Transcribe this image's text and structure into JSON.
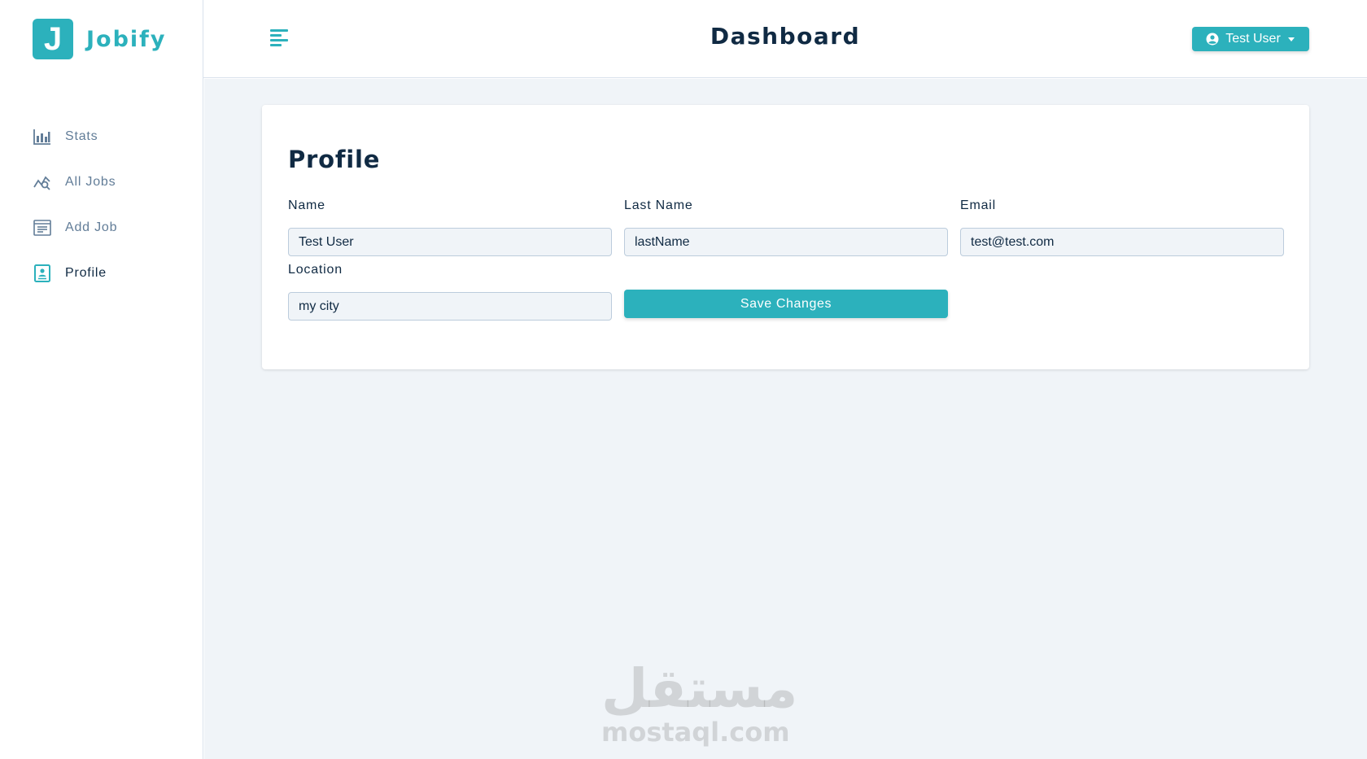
{
  "brand": {
    "logo_letter": "J",
    "name": "Jobify",
    "accent_color": "#2cb1bc"
  },
  "sidebar": {
    "items": [
      {
        "label": "Stats",
        "icon": "bar-chart-icon",
        "active": false
      },
      {
        "label": "All Jobs",
        "icon": "chart-search-icon",
        "active": false
      },
      {
        "label": "Add Job",
        "icon": "form-add-icon",
        "active": false
      },
      {
        "label": "Profile",
        "icon": "id-card-icon",
        "active": true
      }
    ]
  },
  "header": {
    "title": "Dashboard",
    "menu_icon": "align-left-icon",
    "user_button": {
      "label": "Test User",
      "icon": "user-circle-icon",
      "caret": "caret-down-icon"
    }
  },
  "profile": {
    "title": "Profile",
    "fields": {
      "name": {
        "label": "Name",
        "value": "Test User"
      },
      "last_name": {
        "label": "Last Name",
        "value": "lastName"
      },
      "email": {
        "label": "Email",
        "value": "test@test.com"
      },
      "location": {
        "label": "Location",
        "value": "my city"
      }
    },
    "save_label": "Save Changes"
  },
  "watermark": {
    "arabic": "مستقل",
    "latin": "mostaql.com"
  }
}
